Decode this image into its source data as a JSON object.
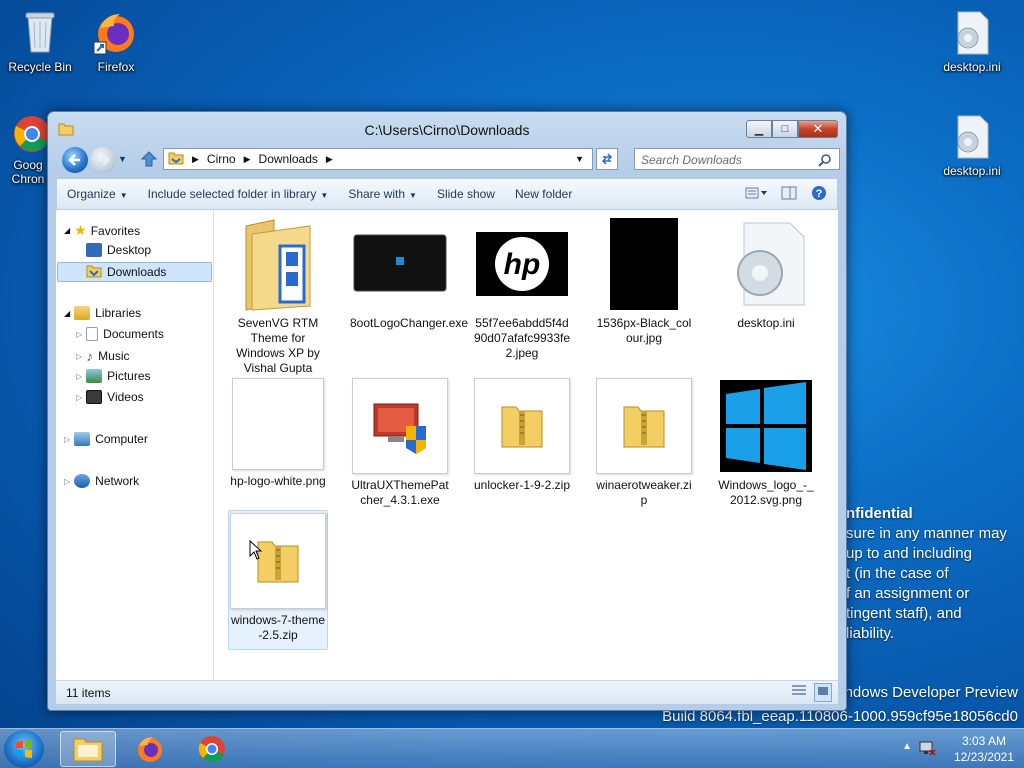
{
  "desktop": {
    "icons": [
      {
        "label": "Recycle Bin"
      },
      {
        "label": "Firefox"
      },
      {
        "label": "Goog Chron"
      },
      {
        "label": "desktop.ini"
      },
      {
        "label": "desktop.ini"
      }
    ],
    "confidential": {
      "heading": "nfidential",
      "lines": [
        "sure in any manner may",
        "up to and including",
        "t (in the case of",
        "f an assignment or",
        "tingent staff), and",
        "liability."
      ]
    },
    "build_line1": "ndows Developer Preview",
    "build_line2": "Build 8064.fbl_eeap.110806-1000.959cf95e18056cd0"
  },
  "window": {
    "title": "C:\\Users\\Cirno\\Downloads",
    "buttons": {
      "minimize": "▁",
      "maximize": "□",
      "close": "✕"
    },
    "address": {
      "crumbs": [
        "Cirno",
        "Downloads"
      ]
    },
    "search": {
      "placeholder": "Search Downloads"
    },
    "commands": {
      "organize": "Organize",
      "include": "Include selected folder in library",
      "share": "Share with",
      "slideshow": "Slide show",
      "newfolder": "New folder"
    },
    "nav": {
      "favorites": "Favorites",
      "desktop": "Desktop",
      "downloads": "Downloads",
      "libraries": "Libraries",
      "documents": "Documents",
      "music": "Music",
      "pictures": "Pictures",
      "videos": "Videos",
      "computer": "Computer",
      "network": "Network"
    },
    "files": [
      {
        "name": "SevenVG RTM Theme for Windows XP by Vishal Gupta",
        "kind": "folder"
      },
      {
        "name": "8ootLogoChanger.exe",
        "kind": "exe"
      },
      {
        "name": "55f7ee6abdd5f4d90d07afafc9933fe2.jpeg",
        "kind": "hp-jpeg"
      },
      {
        "name": "1536px-Black_colour.jpg",
        "kind": "black"
      },
      {
        "name": "desktop.ini",
        "kind": "ini"
      },
      {
        "name": "hp-logo-white.png",
        "kind": "blank"
      },
      {
        "name": "UltraUXThemePatcher_4.3.1.exe",
        "kind": "exe2"
      },
      {
        "name": "unlocker-1-9-2.zip",
        "kind": "zip"
      },
      {
        "name": "winaerotweaker.zip",
        "kind": "zip"
      },
      {
        "name": "Windows_logo_-_2012.svg.png",
        "kind": "winlogo"
      },
      {
        "name": "windows-7-theme-2.5.zip",
        "kind": "zip"
      }
    ],
    "status": "11 items"
  },
  "taskbar": {
    "time": "3:03 AM",
    "date": "12/23/2021"
  },
  "colors": {
    "accent": "#0b6cc4",
    "selection": "#cde4fb",
    "close": "#c3452c"
  }
}
